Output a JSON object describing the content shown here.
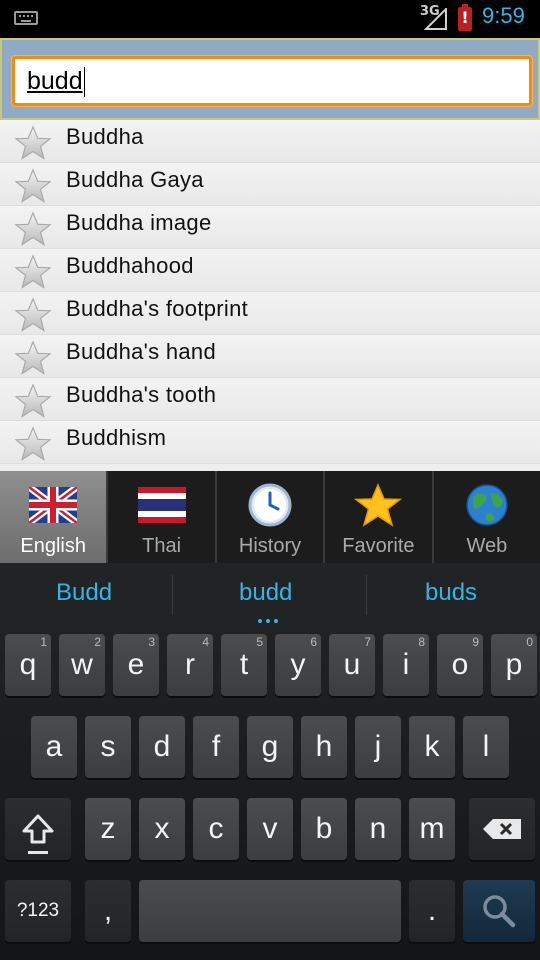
{
  "status_bar": {
    "network": "3G",
    "battery_alert": "!",
    "time": "9:59",
    "time_color": "#33b5e5"
  },
  "search": {
    "value": "budd",
    "border_color": "#f08c10"
  },
  "results": [
    {
      "label": "Buddha"
    },
    {
      "label": "Buddha Gaya"
    },
    {
      "label": "Buddha image"
    },
    {
      "label": "Buddhahood"
    },
    {
      "label": "Buddha's footprint"
    },
    {
      "label": "Buddha's hand"
    },
    {
      "label": "Buddha's tooth"
    },
    {
      "label": "Buddhism"
    }
  ],
  "tabs": [
    {
      "label": "English",
      "icon": "uk-flag-icon",
      "active": true
    },
    {
      "label": "Thai",
      "icon": "thai-flag-icon",
      "active": false
    },
    {
      "label": "History",
      "icon": "clock-icon",
      "active": false
    },
    {
      "label": "Favorite",
      "icon": "star-icon",
      "active": false
    },
    {
      "label": "Web",
      "icon": "globe-icon",
      "active": false
    }
  ],
  "keyboard": {
    "suggestions": [
      "Budd",
      "budd",
      "buds"
    ],
    "row1": [
      {
        "key": "q",
        "hint": "1"
      },
      {
        "key": "w",
        "hint": "2"
      },
      {
        "key": "e",
        "hint": "3"
      },
      {
        "key": "r",
        "hint": "4"
      },
      {
        "key": "t",
        "hint": "5"
      },
      {
        "key": "y",
        "hint": "6"
      },
      {
        "key": "u",
        "hint": "7"
      },
      {
        "key": "i",
        "hint": "8"
      },
      {
        "key": "o",
        "hint": "9"
      },
      {
        "key": "p",
        "hint": "0"
      }
    ],
    "row2": [
      "a",
      "s",
      "d",
      "f",
      "g",
      "h",
      "j",
      "k",
      "l"
    ],
    "row3": [
      "z",
      "x",
      "c",
      "v",
      "b",
      "n",
      "m"
    ],
    "symbols_label": "?123",
    "comma_label": ",",
    "period_label": ".",
    "accent_color": "#33b5e5"
  }
}
